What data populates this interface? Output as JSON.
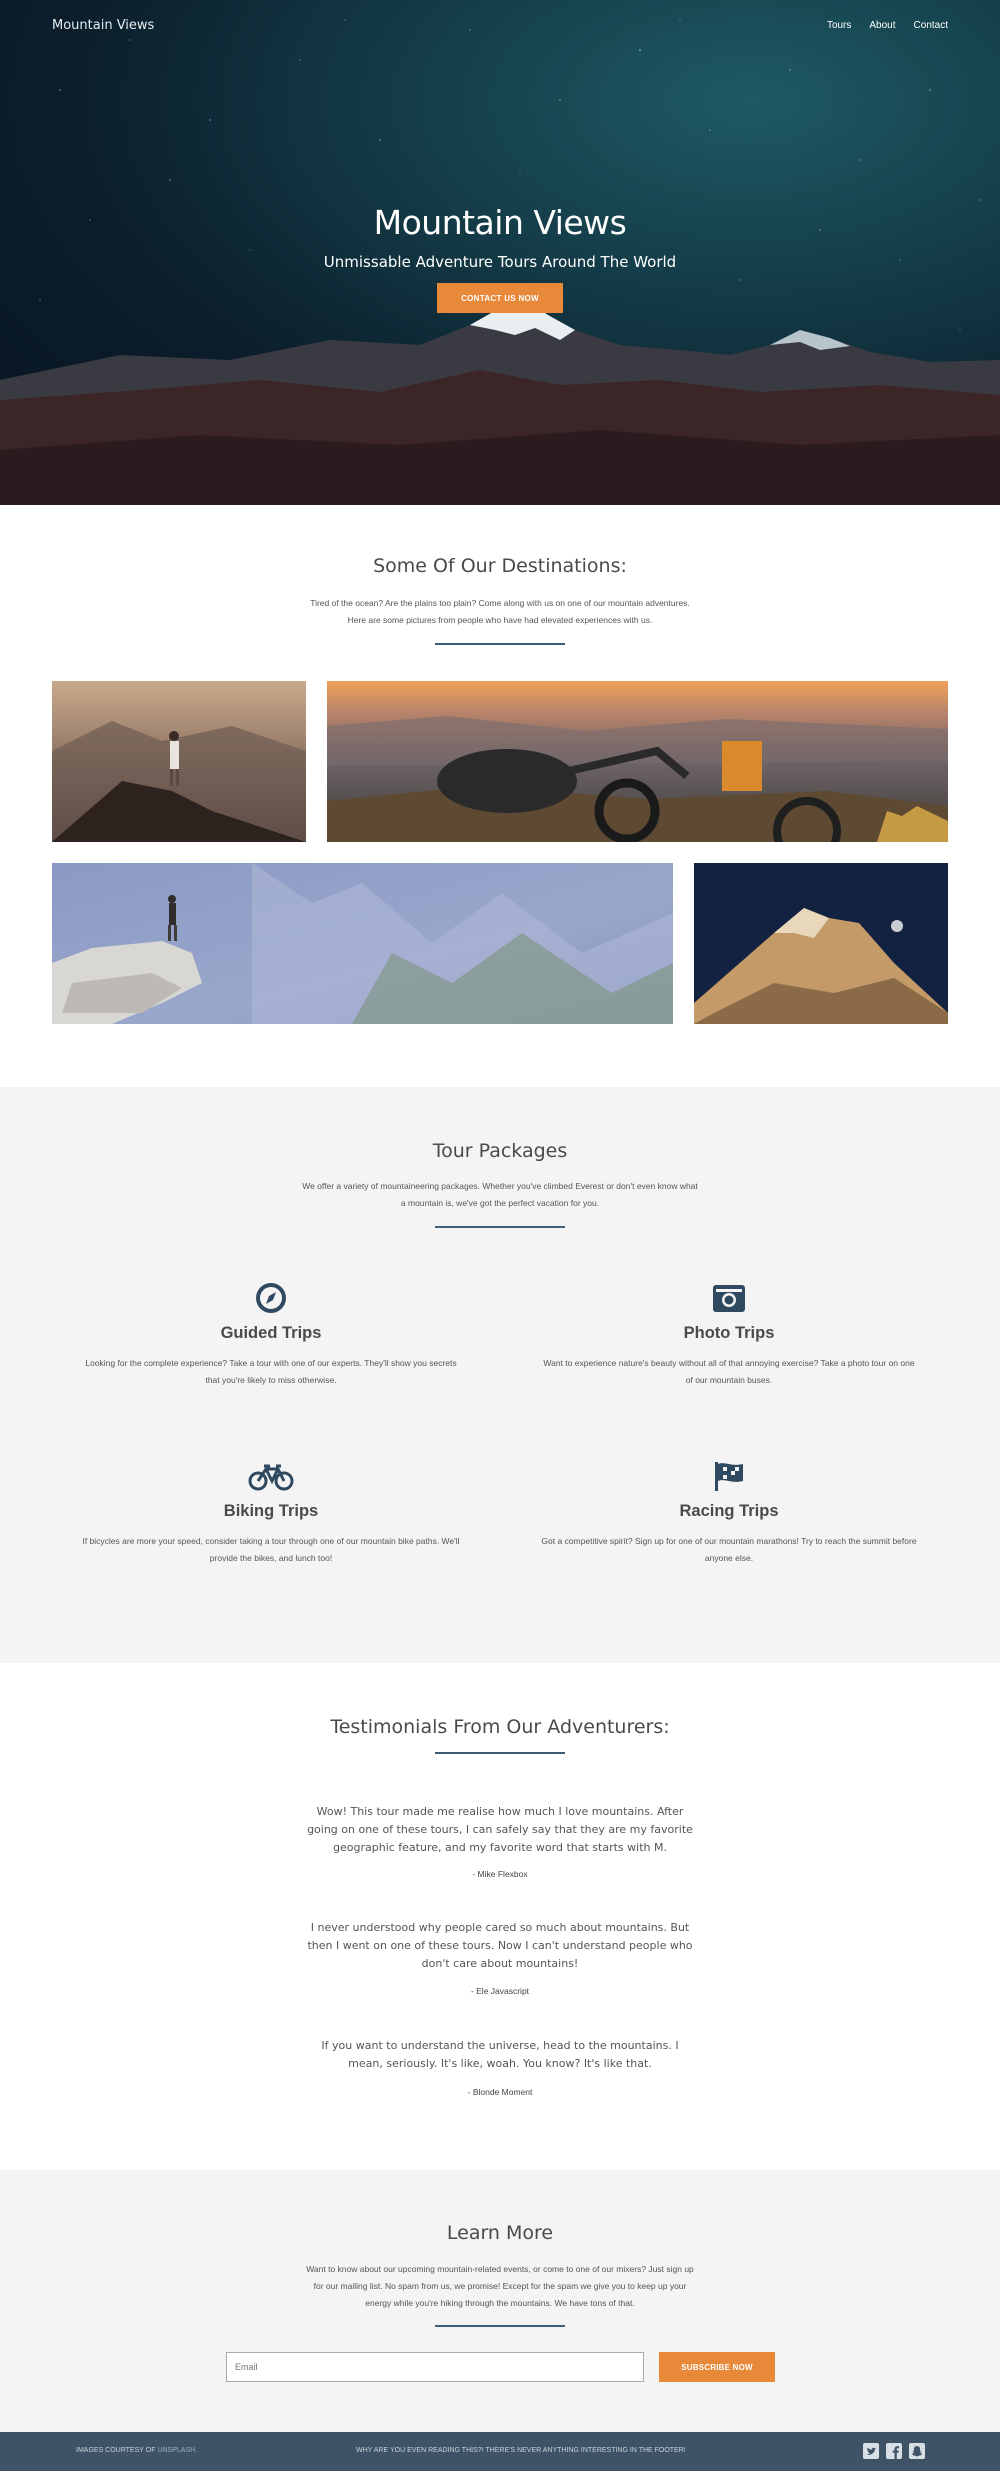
{
  "nav": {
    "brand": "Mountain Views",
    "links": [
      "Tours",
      "About",
      "Contact"
    ]
  },
  "hero": {
    "title": "Mountain Views",
    "subtitle": "Unmissable Adventure Tours Around The World",
    "button": "CONTACT US NOW"
  },
  "destinations": {
    "title": "Some Of Our Destinations:",
    "text": "Tired of the ocean? Are the plains too plain? Come along with us on one of our mountain adventures. Here are some pictures from people who have had elevated experiences with us.",
    "photos": [
      "hiker-on-ridge-photo",
      "motorbike-overlook-photo",
      "climber-on-cliff-photo",
      "snowy-peak-moon-photo"
    ]
  },
  "tours": {
    "title": "Tour Packages",
    "text": "We offer a variety of mountaineering packages. Whether you've climbed Everest or don't even know what a mountain is, we've got the perfect vacation for you.",
    "items": [
      {
        "icon": "compass-icon",
        "title": "Guided Trips",
        "text": "Looking for the complete experience? Take a tour with one of our experts. They'll show you secrets that you're likely to miss otherwise."
      },
      {
        "icon": "camera-icon",
        "title": "Photo Trips",
        "text": "Want to experience nature's beauty without all of that annoying exercise? Take a photo tour on one of our mountain buses."
      },
      {
        "icon": "bicycle-icon",
        "title": "Biking Trips",
        "text": "If bicycles are more your speed, consider taking a tour through one of our mountain bike paths. We'll provide the bikes, and lunch too!"
      },
      {
        "icon": "flag-icon",
        "title": "Racing Trips",
        "text": "Got a competitive spirit? Sign up for one of our mountain marathons! Try to reach the summit before anyone else."
      }
    ]
  },
  "testimonials": {
    "title": "Testimonials From Our Adventurers:",
    "items": [
      {
        "quote": "Wow! This tour made me realise how much I love mountains. After going on one of these tours, I can safely say that they are my favorite geographic feature, and my favorite word that starts with M.",
        "author": "- Mike Flexbox"
      },
      {
        "quote": "I never understood why people cared so much about mountains. But then I went on one of these tours. Now I can't understand people who don't care about mountains!",
        "author": "- Ele Javascript"
      },
      {
        "quote": "If you want to understand the universe, head to the mountains. I mean, seriously. It's like, woah. You know? It's like that.",
        "author": "- Blonde Moment"
      }
    ]
  },
  "learn": {
    "title": "Learn More",
    "text": "Want to know about our upcoming mountain-related events, or come to one of our mixers? Just sign up for our mailing list. No spam from us, we promise! Except for the spam we give you to keep up your energy while you're hiking through the mountains. We have tons of that.",
    "email_placeholder": "Email",
    "button": "SUBSCRIBE NOW"
  },
  "footer": {
    "credit_prefix": "IMAGES COURTESY OF",
    "credit_link": "UNSPLASH.",
    "middle": "WHY ARE YOU EVEN READING THIS?! THERE'S NEVER ANYTHING INTERESTING IN THE FOOTER!",
    "social": [
      "twitter-icon",
      "facebook-icon",
      "snapchat-icon"
    ]
  },
  "colors": {
    "accent": "#e8893a",
    "divider": "#3e5c76",
    "footer": "#3e5466",
    "icon": "#2f4a60",
    "light_section": "#f4f4f4"
  }
}
